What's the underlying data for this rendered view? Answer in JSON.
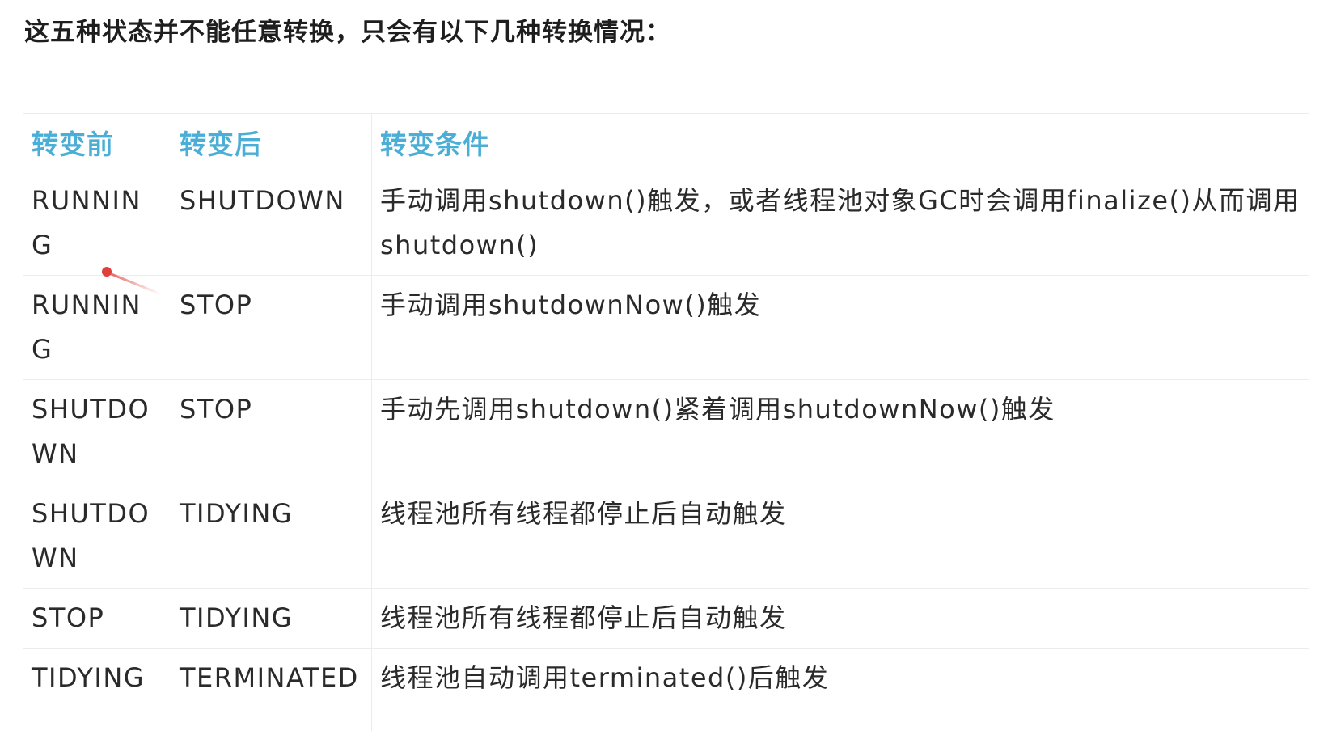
{
  "heading": "这五种状态并不能任意转换，只会有以下几种转换情况：",
  "table": {
    "headers": [
      "转变前",
      "转变后",
      "转变条件"
    ],
    "rows": [
      {
        "before": "RUNNING",
        "after": "SHUTDOWN",
        "condition": "手动调用shutdown()触发，或者线程池对象GC时会调用finalize()从而调用shutdown()"
      },
      {
        "before": "RUNNING",
        "after": "STOP",
        "condition": "手动调用shutdownNow()触发"
      },
      {
        "before": "SHUTDOWN",
        "after": "STOP",
        "condition": "手动先调用shutdown()紧着调用shutdownNow()触发"
      },
      {
        "before": "SHUTDOWN",
        "after": "TIDYING",
        "condition": "线程池所有线程都停止后自动触发"
      },
      {
        "before": "STOP",
        "after": "TIDYING",
        "condition": "线程池所有线程都停止后自动触发"
      },
      {
        "before": "TIDYING",
        "after": "TERMINATED",
        "condition": "线程池自动调用terminated()后触发"
      }
    ]
  },
  "colors": {
    "header_text": "#4aaed6",
    "border": "#ececec",
    "marker": "#e0403a"
  }
}
